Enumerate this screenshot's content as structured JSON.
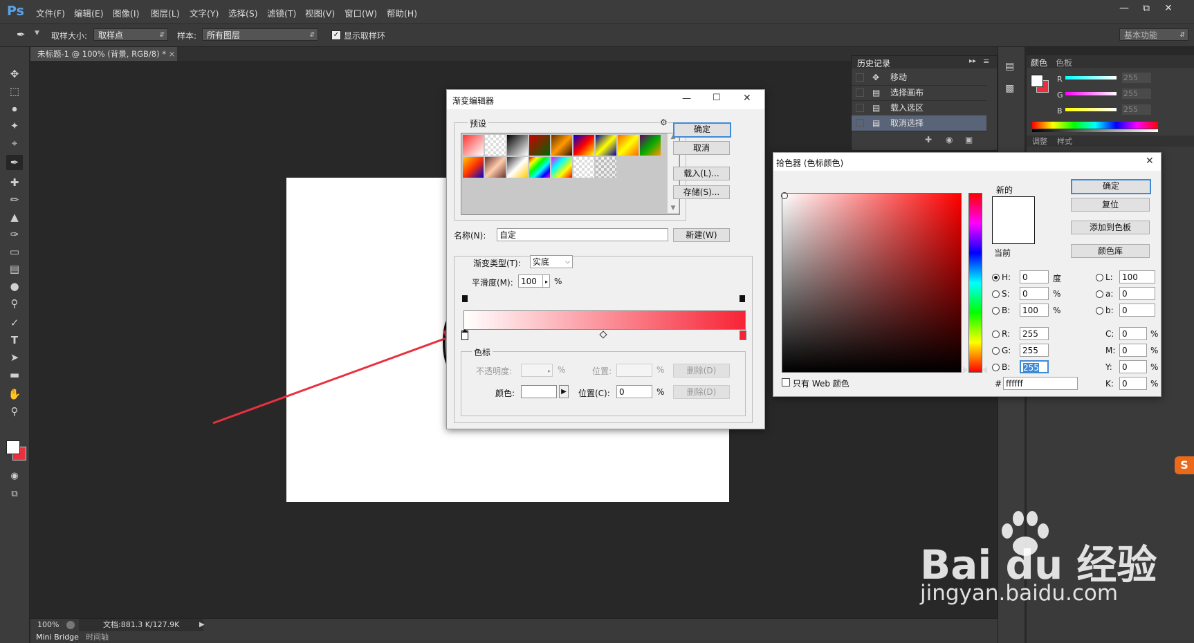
{
  "app": {
    "logo": "Ps"
  },
  "menu": [
    "文件(F)",
    "编辑(E)",
    "图像(I)",
    "图层(L)",
    "文字(Y)",
    "选择(S)",
    "滤镜(T)",
    "视图(V)",
    "窗口(W)",
    "帮助(H)"
  ],
  "options": {
    "sample_size_label": "取样大小:",
    "sample_size_value": "取样点",
    "sample_label": "样本:",
    "sample_value": "所有图层",
    "show_ring_label": "显示取样环",
    "workspace": "基本功能"
  },
  "document": {
    "tab_title": "未标题-1 @ 100% (背景, RGB/8) *"
  },
  "status": {
    "zoom": "100%",
    "doc_info": "文档:881.3 K/127.9K"
  },
  "bottom_tabs": [
    "Mini Bridge",
    "时间轴"
  ],
  "history": {
    "title": "历史记录",
    "items": [
      "移动",
      "选择画布",
      "载入选区",
      "取消选择"
    ]
  },
  "color_panel": {
    "tabs": [
      "颜色",
      "色板"
    ],
    "channels": [
      {
        "label": "R",
        "value": "255"
      },
      {
        "label": "G",
        "value": "255"
      },
      {
        "label": "B",
        "value": "255"
      }
    ],
    "lower_tabs": [
      "调整",
      "样式"
    ]
  },
  "gradient_editor": {
    "title": "渐变编辑器",
    "presets_label": "预设",
    "buttons": {
      "ok": "确定",
      "cancel": "取消",
      "load": "载入(L)...",
      "save": "存储(S)...",
      "new": "新建(W)"
    },
    "name_label": "名称(N):",
    "name_value": "自定",
    "type_label": "渐变类型(T):",
    "type_value": "实底",
    "smooth_label": "平滑度(M):",
    "smooth_value": "100",
    "percent": "%",
    "stops_label": "色标",
    "opacity_label": "不透明度:",
    "location_label": "位置:",
    "delete_label": "删除(D)",
    "color_label": "颜色:",
    "color_location_label": "位置(C):",
    "color_location_value": "0",
    "gradient_end_color": "#f72335"
  },
  "color_picker": {
    "title": "拾色器 (色标颜色)",
    "new_label": "新的",
    "current_label": "当前",
    "buttons": {
      "ok": "确定",
      "reset": "复位",
      "add_swatch": "添加到色板",
      "libraries": "颜色库"
    },
    "web_only_label": "只有 Web 颜色",
    "hsb": [
      {
        "label": "H:",
        "value": "0",
        "unit": "度",
        "selected": true
      },
      {
        "label": "S:",
        "value": "0",
        "unit": "%",
        "selected": false
      },
      {
        "label": "B:",
        "value": "100",
        "unit": "%",
        "selected": false
      }
    ],
    "rgb": [
      {
        "label": "R:",
        "value": "255"
      },
      {
        "label": "G:",
        "value": "255"
      },
      {
        "label": "B:",
        "value": "255"
      }
    ],
    "lab": [
      {
        "label": "L:",
        "value": "100"
      },
      {
        "label": "a:",
        "value": "0"
      },
      {
        "label": "b:",
        "value": "0"
      }
    ],
    "cmyk": [
      {
        "label": "C:",
        "value": "0",
        "unit": "%"
      },
      {
        "label": "M:",
        "value": "0",
        "unit": "%"
      },
      {
        "label": "Y:",
        "value": "0",
        "unit": "%"
      },
      {
        "label": "K:",
        "value": "0",
        "unit": "%"
      }
    ],
    "hex_label": "#",
    "hex_value": "ffffff"
  },
  "watermark": {
    "brand": "Bai du 经验",
    "url": "jingyan.baidu.com"
  },
  "colors": {
    "accent_red": "#e8303e",
    "selection_blue": "#3c8ad8"
  }
}
